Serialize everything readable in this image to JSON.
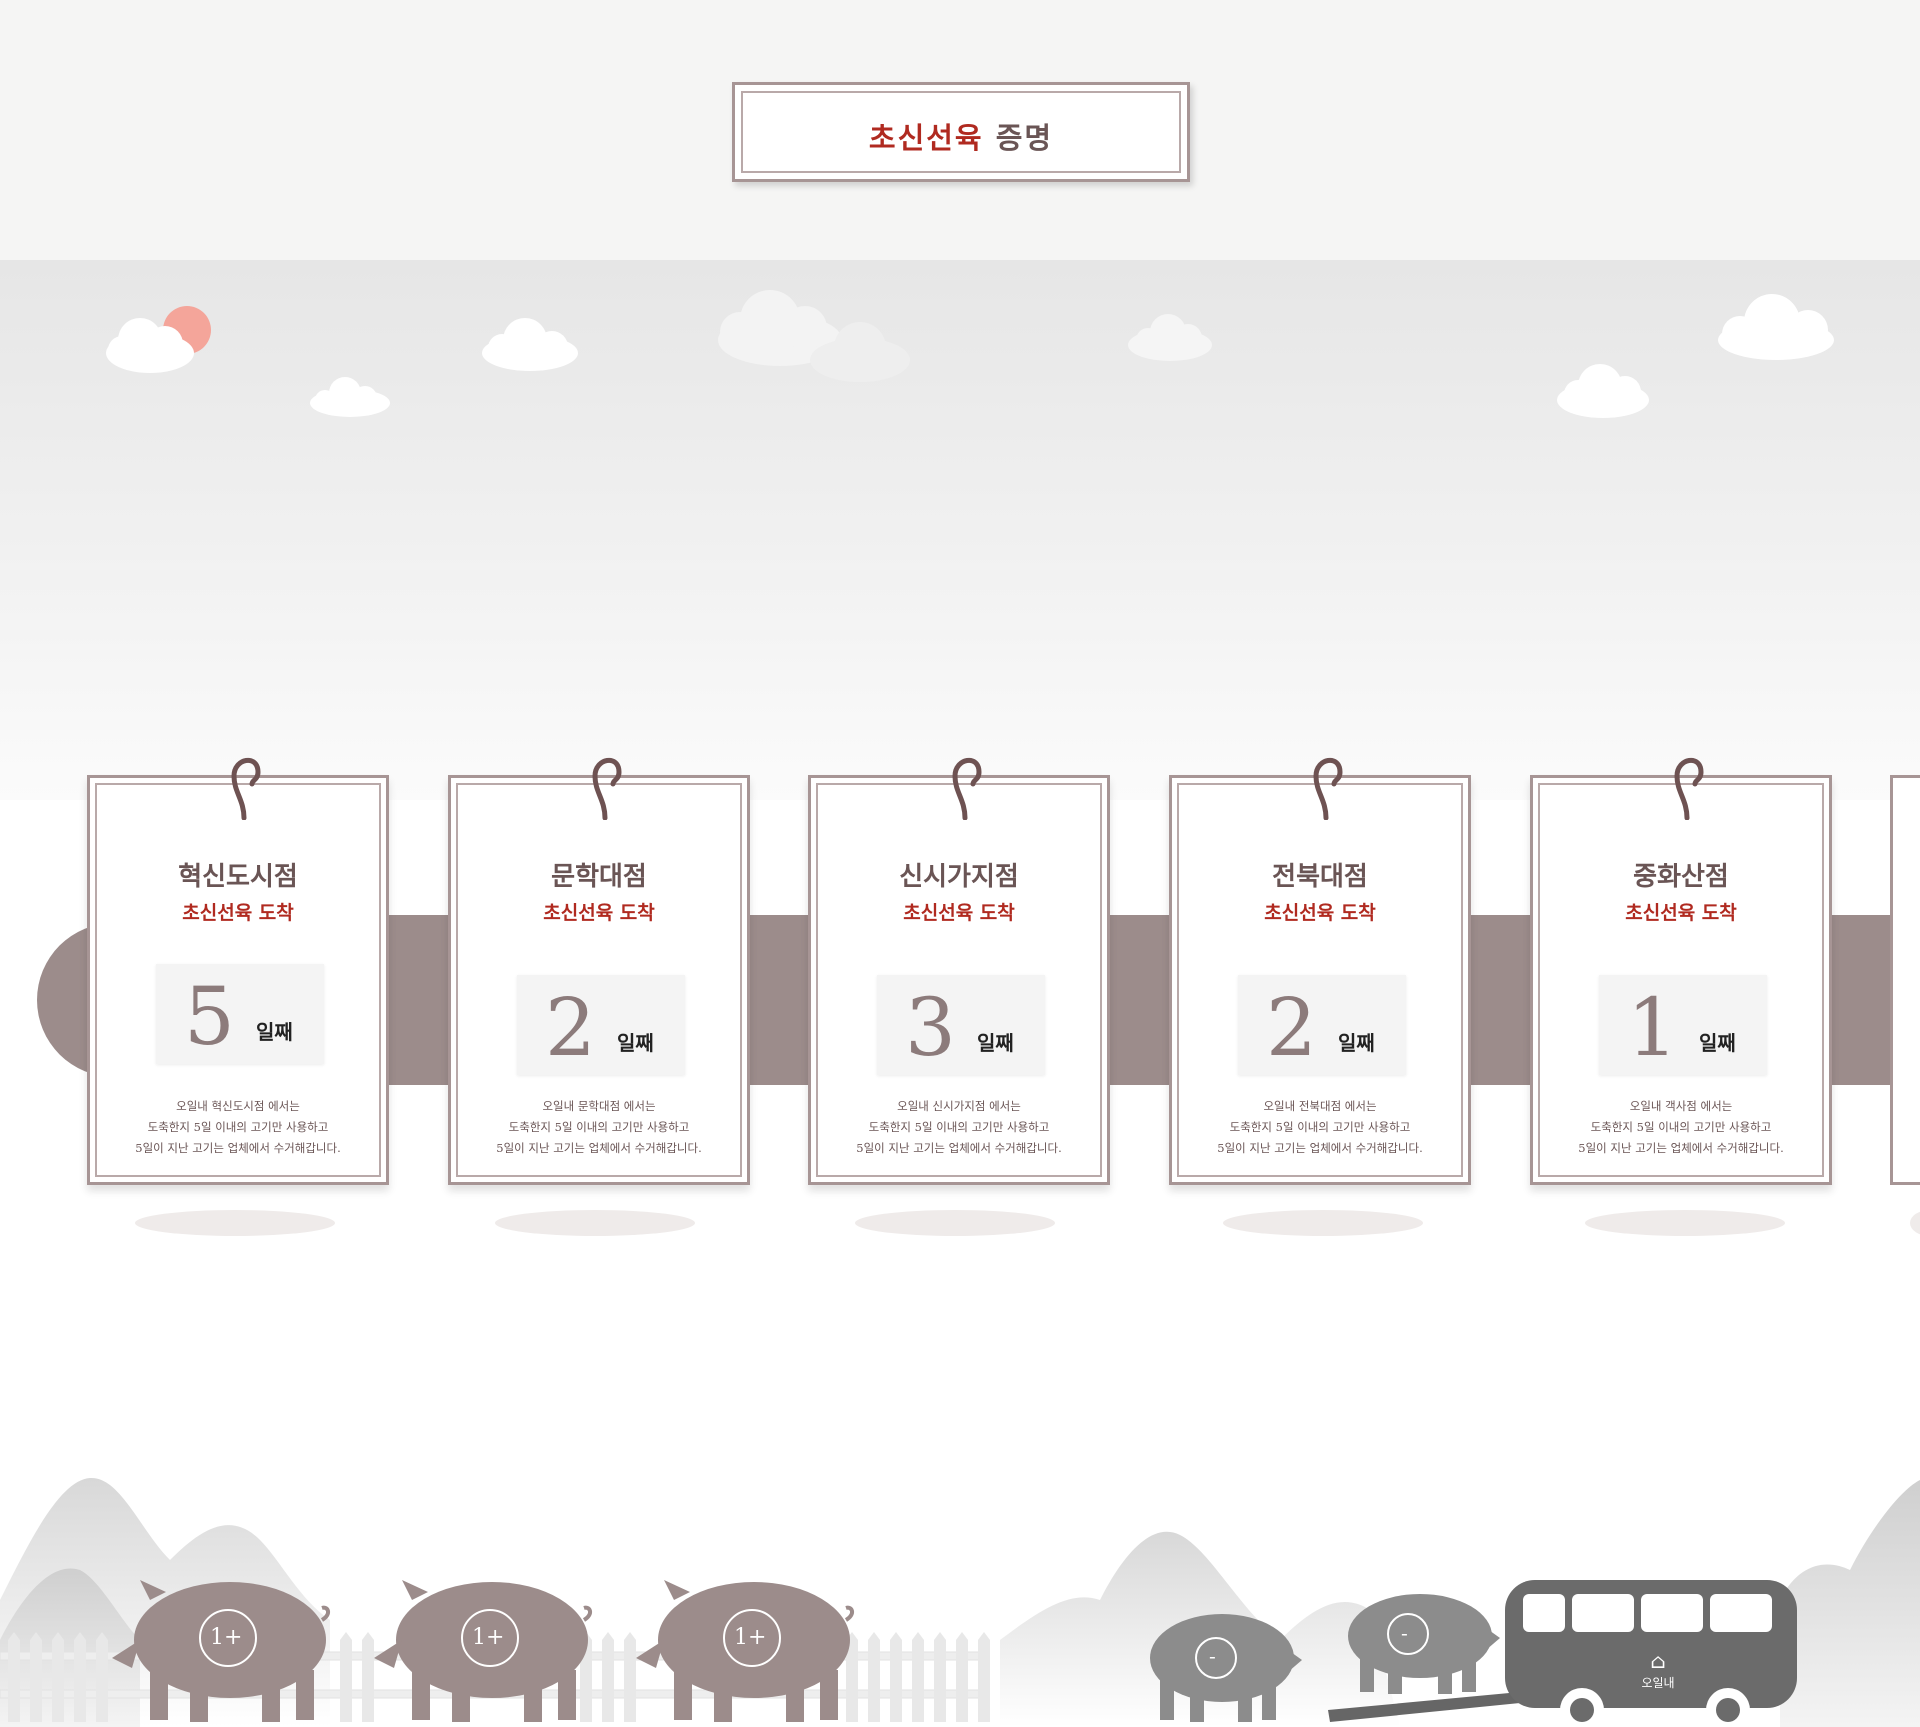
{
  "header": {
    "title_red": "초신선육",
    "title_dark": "증명"
  },
  "cards": [
    {
      "shop": "혁신도시점",
      "arrive": "초신선육 도착",
      "day_number": "5",
      "day_label": "일째",
      "desc_line1": "오일내 혁신도시점 에서는",
      "desc_line2": "도축한지 5일 이내의 고기만 사용하고",
      "desc_line3": "5일이 지난 고기는 업체에서 수거해갑니다."
    },
    {
      "shop": "문학대점",
      "arrive": "초신선육 도착",
      "day_number": "2",
      "day_label": "일째",
      "desc_line1": "오일내 문학대점 에서는",
      "desc_line2": "도축한지 5일 이내의 고기만 사용하고",
      "desc_line3": "5일이 지난 고기는 업체에서 수거해갑니다."
    },
    {
      "shop": "신시가지점",
      "arrive": "초신선육 도착",
      "day_number": "3",
      "day_label": "일째",
      "desc_line1": "오일내 신시가지점 에서는",
      "desc_line2": "도축한지 5일 이내의 고기만 사용하고",
      "desc_line3": "5일이 지난 고기는 업체에서 수거해갑니다."
    },
    {
      "shop": "전북대점",
      "arrive": "초신선육 도착",
      "day_number": "2",
      "day_label": "일째",
      "desc_line1": "오일내 전북대점 에서는",
      "desc_line2": "도축한지 5일 이내의 고기만 사용하고",
      "desc_line3": "5일이 지난 고기는 업체에서 수거해갑니다."
    },
    {
      "shop": "중화산점",
      "arrive": "초신선육 도착",
      "day_number": "1",
      "day_label": "일째",
      "desc_line1": "오일내 객사점 에서는",
      "desc_line2": "도축한지 5일 이내의 고기만 사용하고",
      "desc_line3": "5일이 지난 고기는 업체에서 수거해갑니다."
    }
  ],
  "pigs": {
    "fresh_label": "1+",
    "old_label": "-"
  },
  "truck": {
    "logo_text": "오일내"
  },
  "colors": {
    "accent_red": "#b02a20",
    "brown": "#9c8c8b",
    "text_dark": "#6a5555",
    "sun": "#f4a59a"
  }
}
